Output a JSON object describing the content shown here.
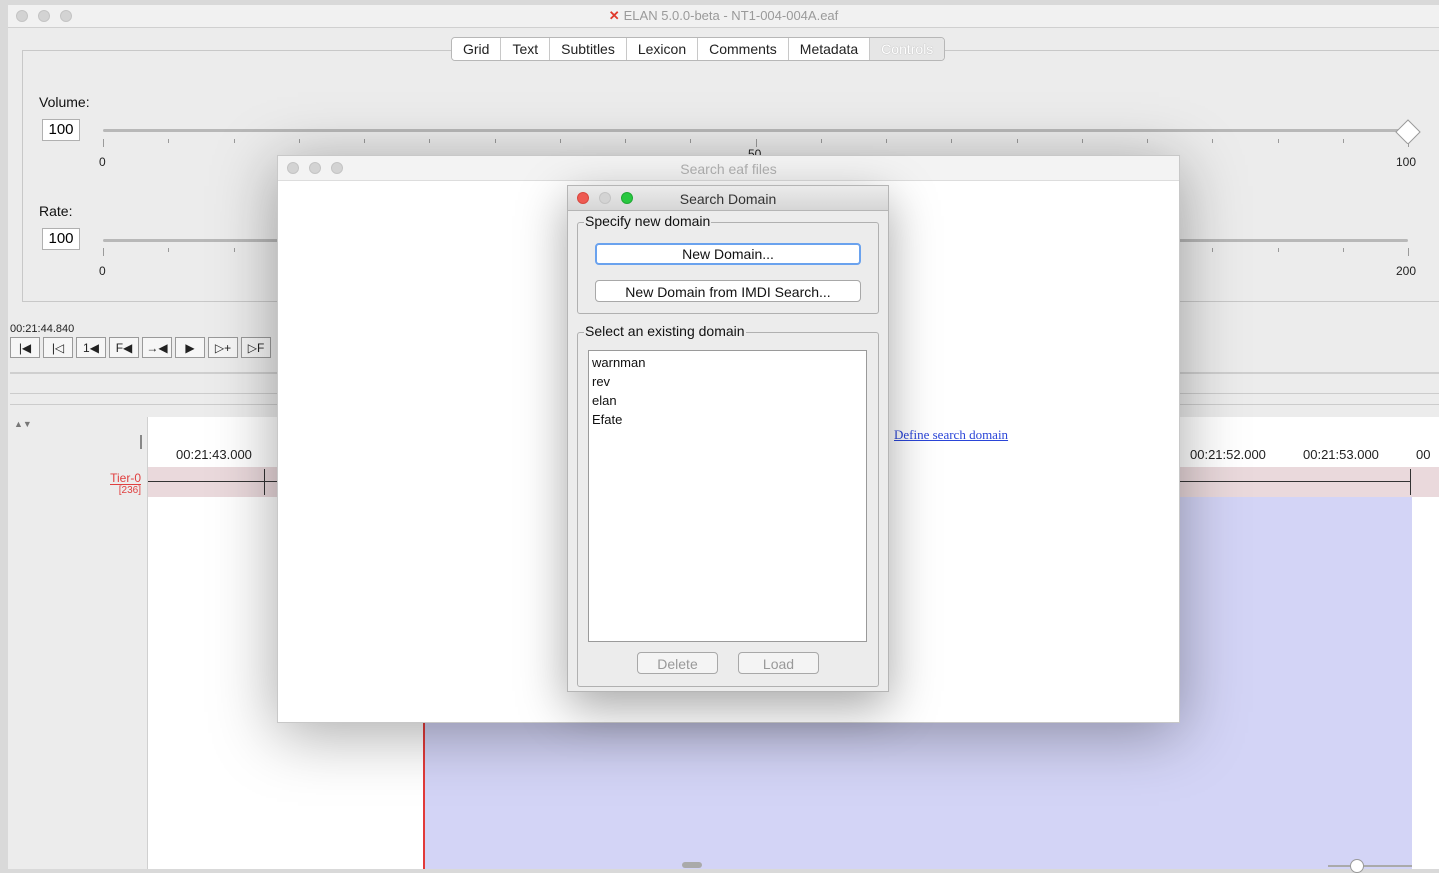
{
  "window": {
    "title": "ELAN 5.0.0-beta - NT1-004-004A.eaf"
  },
  "tabs": [
    {
      "label": "Grid",
      "active": false
    },
    {
      "label": "Text",
      "active": false
    },
    {
      "label": "Subtitles",
      "active": false
    },
    {
      "label": "Lexicon",
      "active": false
    },
    {
      "label": "Comments",
      "active": false
    },
    {
      "label": "Metadata",
      "active": false
    },
    {
      "label": "Controls",
      "active": true
    }
  ],
  "controls": {
    "volume": {
      "label": "Volume:",
      "value": "100",
      "min": "0",
      "mid": "50",
      "max": "100",
      "level": 1.0
    },
    "rate": {
      "label": "Rate:",
      "value": "100",
      "min": "0",
      "max": "200"
    }
  },
  "player": {
    "timecode": "00:21:44.840",
    "buttons": [
      "|◀",
      "|◁",
      "1◀",
      "F◀",
      "→◀",
      "▶",
      "▷+",
      "▷F"
    ]
  },
  "timeline": {
    "time_labels": [
      "00:21:43.000",
      "00:21:52.000",
      "00:21:53.000",
      "00"
    ],
    "tier": {
      "name": "Tier-0",
      "count": "[236]"
    }
  },
  "search_eaf": {
    "title": "Search eaf files",
    "define_link": "Define search domain"
  },
  "search_domain": {
    "title": "Search Domain",
    "new_group_title": "Specify new domain",
    "new_domain_button": "New Domain...",
    "imdi_button": "New Domain from IMDI Search...",
    "existing_group_title": "Select an existing domain",
    "domains": [
      "warnman",
      "rev",
      "elan",
      "Efate"
    ],
    "delete_button": "Delete",
    "load_button": "Load"
  },
  "colors": {
    "close": "#ee5a52",
    "minimize": "#d9d9d9",
    "zoom": "#28c840",
    "tier_red": "#e04040",
    "selection": "#d3d4f6",
    "link": "#2a45d8"
  }
}
